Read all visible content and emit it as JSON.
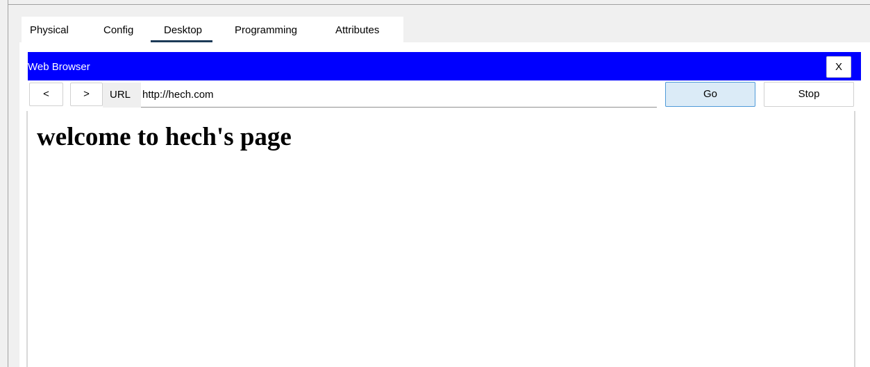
{
  "tabs": [
    {
      "label": "Physical"
    },
    {
      "label": "Config"
    },
    {
      "label": "Desktop",
      "active": true
    },
    {
      "label": "Programming"
    },
    {
      "label": "Attributes"
    }
  ],
  "browser": {
    "title": "Web Browser",
    "close_label": "X",
    "back_label": "<",
    "forward_label": ">",
    "url_label": "URL",
    "url_value": "http://hech.com",
    "go_label": "Go",
    "stop_label": "Stop"
  },
  "page": {
    "heading": "welcome to hech's page"
  },
  "colors": {
    "titlebar": "#0000ff",
    "active_tab_underline": "#1c3a57",
    "go_button_bg": "#dbebf7"
  }
}
